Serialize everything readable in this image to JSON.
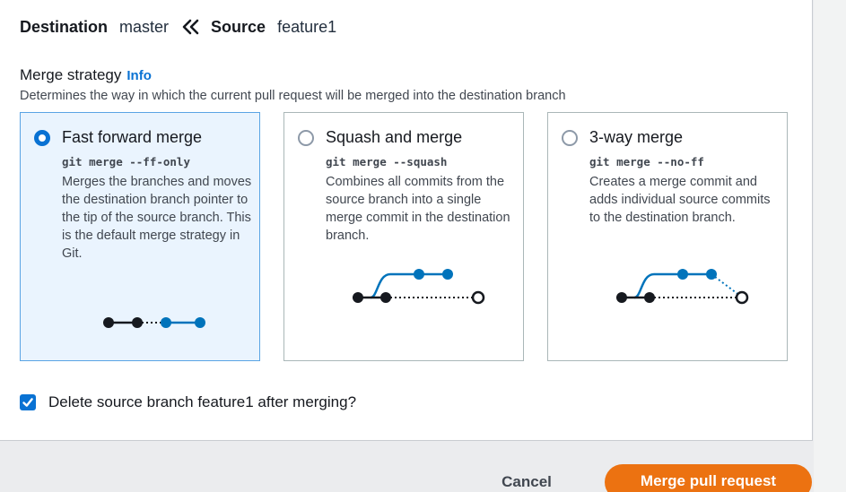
{
  "header": {
    "destination_label": "Destination",
    "destination_value": "master",
    "arrow_icon": "double-chevron-left-icon",
    "source_label": "Source",
    "source_value": "feature1"
  },
  "merge_strategy": {
    "title": "Merge strategy",
    "info_link": "Info",
    "description": "Determines the way in which the current pull request will be merged into the destination branch",
    "options": [
      {
        "title": "Fast forward merge",
        "command": "git merge --ff-only",
        "description": "Merges the branches and moves the destination branch pointer to the tip of the source branch. This is the default merge strategy in Git.",
        "selected": true
      },
      {
        "title": "Squash and merge",
        "command": "git merge --squash",
        "description": "Combines all commits from the source branch into a single merge commit in the destination branch.",
        "selected": false
      },
      {
        "title": "3-way merge",
        "command": "git merge --no-ff",
        "description": "Creates a merge commit and adds individual source commits to the destination branch.",
        "selected": false
      }
    ]
  },
  "delete_branch": {
    "label": "Delete source branch feature1 after merging?",
    "checked": true
  },
  "footer": {
    "cancel_label": "Cancel",
    "merge_label": "Merge pull request"
  },
  "colors": {
    "accent_blue": "#0972d3",
    "branch_blue": "#0073bb",
    "primary_orange": "#ec7211",
    "selected_bg": "#eaf4fe"
  }
}
